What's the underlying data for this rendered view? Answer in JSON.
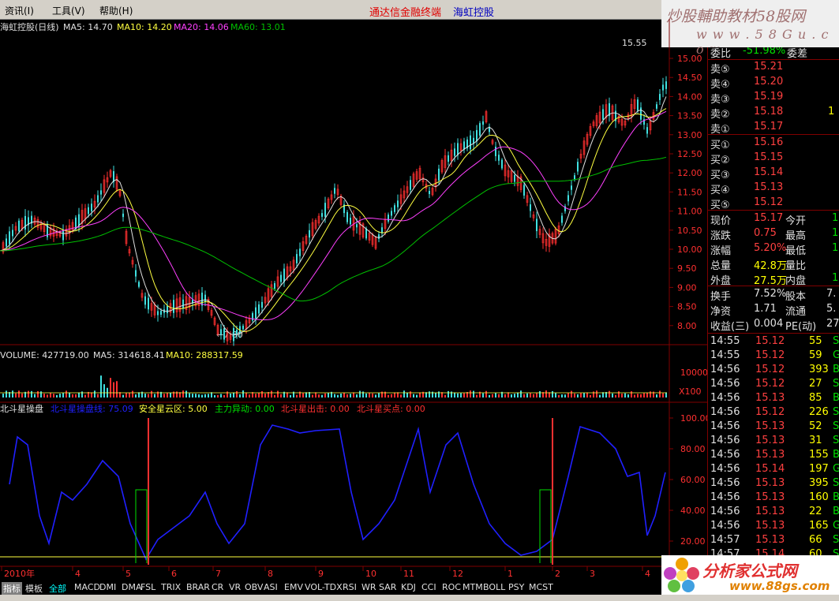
{
  "menu": {
    "items": [
      "资讯(I)",
      "工具(V)",
      "帮助(H)"
    ],
    "terminal": "通达信金融终端",
    "stock": "海虹控股"
  },
  "brand": {
    "line1": "炒股輔助教材58股网",
    "line2": "w w w . 5 8 G u . c o m"
  },
  "ma_header": {
    "name": "海虹控股(日线)",
    "ma5": "MA5: 14.70",
    "ma10": "MA10: 14.20",
    "ma20": "MA20: 14.06",
    "ma60": "MA60: 13.01"
  },
  "price_axis": [
    "15.00",
    "14.50",
    "14.00",
    "13.50",
    "13.00",
    "12.50",
    "12.00",
    "11.50",
    "11.00",
    "10.50",
    "10.00",
    "9.50",
    "9.00",
    "8.50",
    "8.00"
  ],
  "high_mark": "15.55",
  "low_mark": "←7.80",
  "volume_header": {
    "volume": "VOLUME: 427719.00",
    "ma5": "MA5: 314618.41",
    "ma10": "MA10: 288317.59"
  },
  "volume_axis": [
    "10000",
    "X100"
  ],
  "indicator_header": {
    "name": "北斗星操盘",
    "line1": "北斗星操盘线: 75.09",
    "safe": "安全星云区: 5.00",
    "main": "主力异动: 0.00",
    "sell": "北斗星出击: 0.00",
    "buy": "北斗星买点: 0.00"
  },
  "indicator_axis": [
    "100.00",
    "80.00",
    "60.00",
    "40.00",
    "20.00"
  ],
  "date_axis": [
    "2010年",
    "4",
    "5",
    "6",
    "7",
    "8",
    "9",
    "10",
    "11",
    "12",
    "1",
    "2",
    "3",
    "4"
  ],
  "quote": {
    "ratio_label": "委比",
    "ratio_value": "-51.98%",
    "diff_label": "委差",
    "sell": [
      {
        "label": "卖⑤",
        "price": "15.21",
        "vol": ""
      },
      {
        "label": "卖④",
        "price": "15.20",
        "vol": ""
      },
      {
        "label": "卖③",
        "price": "15.19",
        "vol": ""
      },
      {
        "label": "卖②",
        "price": "15.18",
        "vol": "1"
      },
      {
        "label": "卖①",
        "price": "15.17",
        "vol": ""
      }
    ],
    "buy": [
      {
        "label": "买①",
        "price": "15.16"
      },
      {
        "label": "买②",
        "price": "15.15"
      },
      {
        "label": "买③",
        "price": "15.14"
      },
      {
        "label": "买④",
        "price": "15.13"
      },
      {
        "label": "买⑤",
        "price": "15.12"
      }
    ],
    "stats": [
      {
        "l1": "现价",
        "v1": "15.17",
        "l2": "今开",
        "v2": "1"
      },
      {
        "l1": "涨跌",
        "v1": "0.75",
        "l2": "最高",
        "v2": "1"
      },
      {
        "l1": "涨幅",
        "v1": "5.20%",
        "l2": "最低",
        "v2": "1"
      },
      {
        "l1": "总量",
        "v1": "42.8万",
        "l2": "量比",
        "v2": ""
      },
      {
        "l1": "外盘",
        "v1": "27.5万",
        "l2": "内盘",
        "v2": "15"
      }
    ],
    "stats2": [
      {
        "l1": "换手",
        "v1": "7.52%",
        "l2": "股本",
        "v2": "7."
      },
      {
        "l1": "净资",
        "v1": "1.71",
        "l2": "流通",
        "v2": "5."
      },
      {
        "l1": "收益(三)",
        "v1": "0.004",
        "l2": "PE(动)",
        "v2": "27"
      }
    ],
    "ticks": [
      {
        "t": "14:55",
        "p": "15.12",
        "v": "55",
        "s": "S"
      },
      {
        "t": "14:55",
        "p": "15.12",
        "v": "59",
        "s": "G"
      },
      {
        "t": "14:56",
        "p": "15.12",
        "v": "393",
        "s": "B"
      },
      {
        "t": "14:56",
        "p": "15.12",
        "v": "27",
        "s": "S"
      },
      {
        "t": "14:56",
        "p": "15.13",
        "v": "85",
        "s": "B"
      },
      {
        "t": "14:56",
        "p": "15.12",
        "v": "226",
        "s": "S"
      },
      {
        "t": "14:56",
        "p": "15.13",
        "v": "52",
        "s": "S"
      },
      {
        "t": "14:56",
        "p": "15.13",
        "v": "31",
        "s": "S"
      },
      {
        "t": "14:56",
        "p": "15.13",
        "v": "155",
        "s": "B"
      },
      {
        "t": "14:56",
        "p": "15.14",
        "v": "197",
        "s": "G"
      },
      {
        "t": "14:56",
        "p": "15.13",
        "v": "395",
        "s": "S"
      },
      {
        "t": "14:56",
        "p": "15.13",
        "v": "160",
        "s": "B"
      },
      {
        "t": "14:56",
        "p": "15.13",
        "v": "22",
        "s": "B"
      },
      {
        "t": "14:56",
        "p": "15.13",
        "v": "165",
        "s": "G"
      },
      {
        "t": "14:57",
        "p": "15.13",
        "v": "66",
        "s": "S"
      },
      {
        "t": "14:57",
        "p": "15.14",
        "v": "60",
        "s": "S"
      }
    ]
  },
  "tabs": [
    "指标",
    "模板",
    "全部",
    "MACD",
    "DMI",
    "DMA",
    "FSL",
    "TRIX",
    "BRAR",
    "CR",
    "VR",
    "OBV",
    "ASI",
    "EMV",
    "VOL-TDX",
    "RSI",
    "WR",
    "SAR",
    "KDJ",
    "CCI",
    "ROC",
    "MTM",
    "BOLL",
    "PSY",
    "MCST"
  ],
  "logo": {
    "line1": "分析家公式网",
    "line2": "www.88gs.com"
  },
  "colors": {
    "up": "#ff3030",
    "down": "#40e0e0",
    "ma5": "#e0e0e0",
    "ma10": "#ffff40",
    "ma20": "#ff40ff",
    "ma60": "#00c000",
    "indicator": "#2020ff"
  }
}
